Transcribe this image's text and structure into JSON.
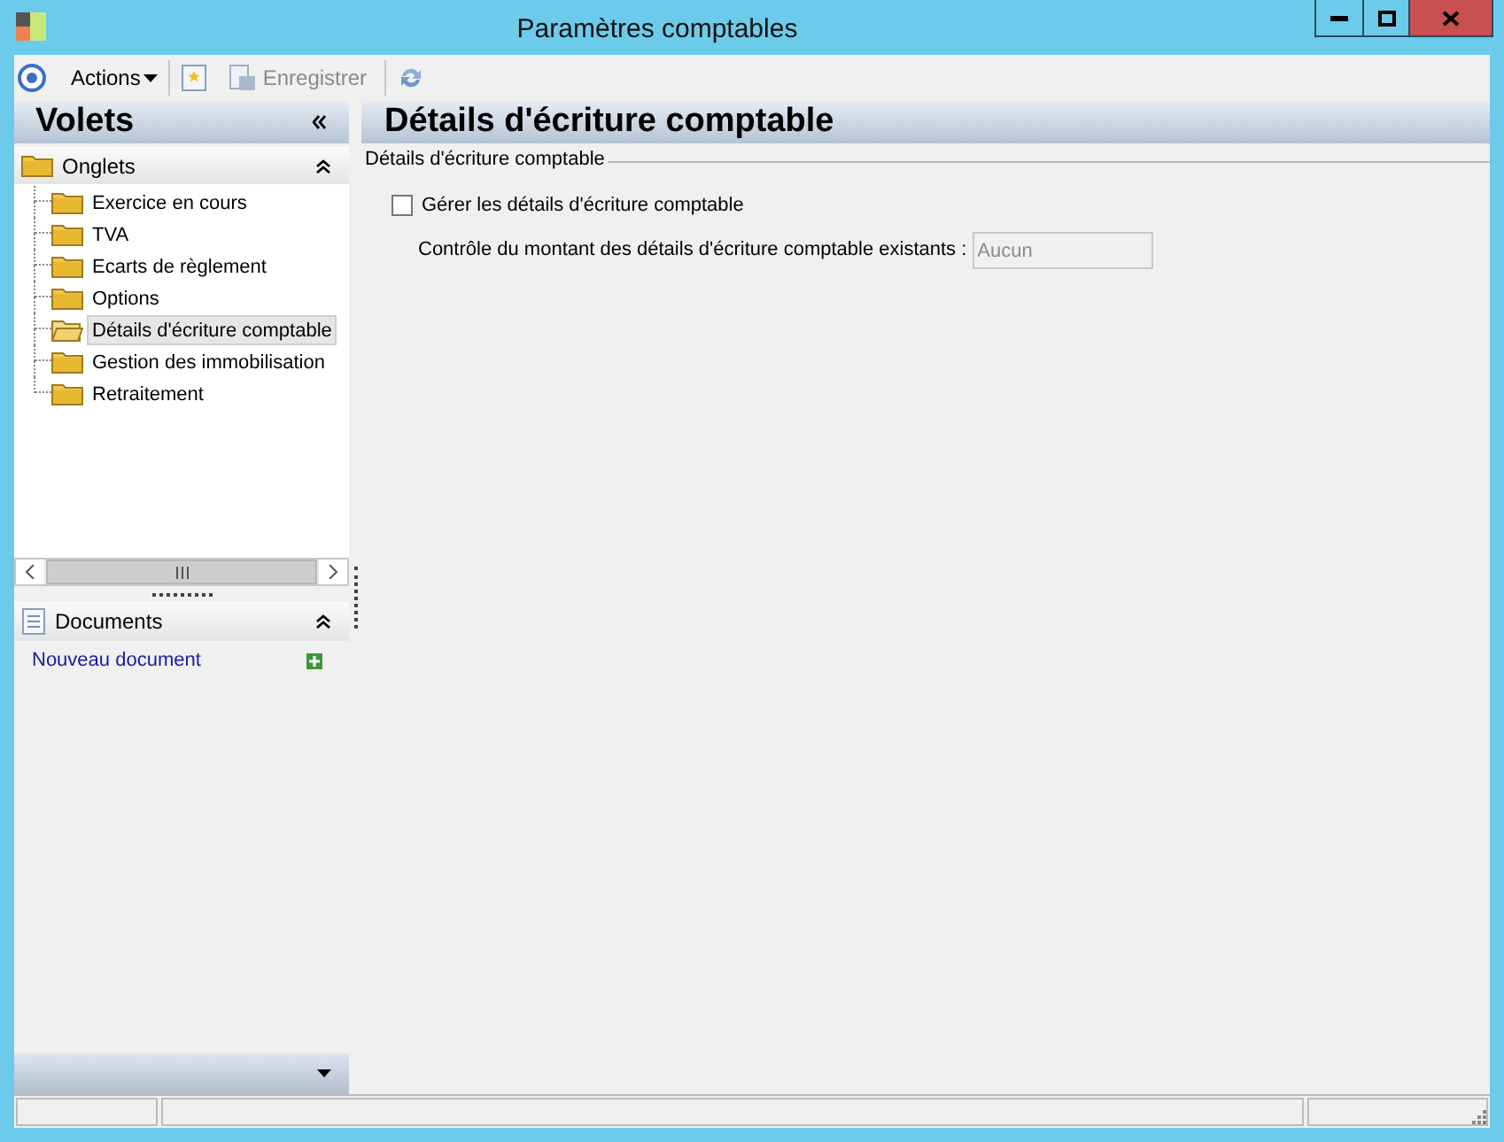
{
  "window": {
    "title": "Paramètres comptables"
  },
  "toolbar": {
    "actions_label": "Actions",
    "save_label": "Enregistrer",
    "save_disabled": true
  },
  "sidebar": {
    "title": "Volets",
    "tabs_section": {
      "title": "Onglets",
      "expanded": true,
      "items": [
        {
          "label": "Exercice en cours",
          "selected": false
        },
        {
          "label": "TVA",
          "selected": false
        },
        {
          "label": "Ecarts de règlement",
          "selected": false
        },
        {
          "label": "Options",
          "selected": false
        },
        {
          "label": "Détails d'écriture comptable",
          "selected": true
        },
        {
          "label": "Gestion des immobilisation",
          "selected": false
        },
        {
          "label": "Retraitement",
          "selected": false
        }
      ]
    },
    "documents_section": {
      "title": "Documents",
      "expanded": true,
      "link": "Nouveau document"
    }
  },
  "content": {
    "title": "Détails d'écriture comptable",
    "group": {
      "legend": "Détails d'écriture comptable",
      "checkbox": {
        "label": "Gérer les détails d'écriture comptable",
        "checked": false
      },
      "field": {
        "label": "Contrôle du montant des détails d'écriture comptable existants :",
        "value": "Aucun",
        "disabled": true
      }
    }
  }
}
